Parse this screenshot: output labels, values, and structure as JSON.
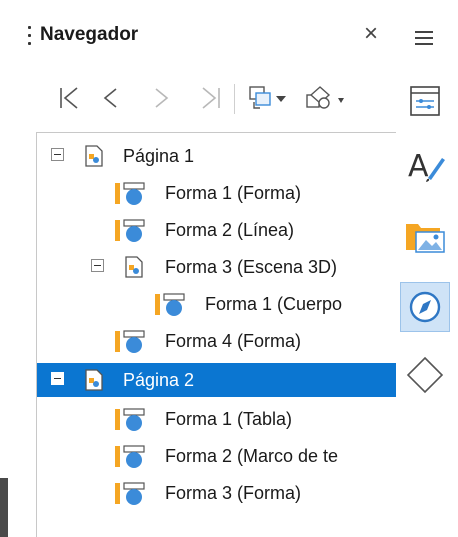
{
  "window": {
    "title": "Navegador",
    "close_icon": "×"
  },
  "toolbar": {
    "icons": [
      "first-icon",
      "previous-icon",
      "next-icon",
      "last-icon",
      "drag-mode-icon",
      "shapes-icon"
    ]
  },
  "tree": {
    "items": [
      {
        "label": "Página 1",
        "type": "page",
        "expanded": true,
        "selected": false
      },
      {
        "label": "Forma 1 (Forma)",
        "type": "shape",
        "selected": false
      },
      {
        "label": "Forma 2 (Línea)",
        "type": "shape",
        "selected": false
      },
      {
        "label": "Forma 3 (Escena 3D)",
        "type": "group",
        "expanded": true,
        "selected": false
      },
      {
        "label": "Forma 1 (Cuerpo",
        "type": "shape",
        "selected": false
      },
      {
        "label": "Forma 4 (Forma)",
        "type": "shape",
        "selected": false
      },
      {
        "label": "Página 2",
        "type": "page",
        "expanded": true,
        "selected": true
      },
      {
        "label": "Forma 1 (Tabla)",
        "type": "shape",
        "selected": false
      },
      {
        "label": "Forma 2 (Marco de te",
        "type": "shape",
        "selected": false
      },
      {
        "label": "Forma 3 (Forma)",
        "type": "shape",
        "selected": false
      }
    ]
  },
  "sidebar": {
    "buttons": [
      {
        "name": "properties-icon",
        "active": false
      },
      {
        "name": "styles-icon",
        "active": false
      },
      {
        "name": "gallery-icon",
        "active": false
      },
      {
        "name": "navigator-icon",
        "active": true
      },
      {
        "name": "shapes-icon",
        "active": false
      }
    ]
  },
  "colors": {
    "selection": "#0b76d1",
    "accent_orange": "#f5a623",
    "accent_blue": "#3b8bd9"
  }
}
